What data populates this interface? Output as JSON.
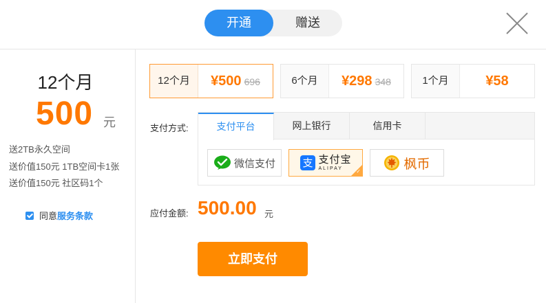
{
  "toggle": {
    "open_label": "开通",
    "gift_label": "赠送"
  },
  "summary": {
    "period": "12个月",
    "price": "500",
    "unit": "元",
    "gifts": [
      "送2TB永久空间",
      "送价值150元 1TB空间卡1张",
      "送价值150元 社区码1个"
    ],
    "agree_prefix": "同意",
    "agree_link": "服务条款"
  },
  "plans": [
    {
      "label": "12个月",
      "price": "¥500",
      "original": "696"
    },
    {
      "label": "6个月",
      "price": "¥298",
      "original": "348"
    },
    {
      "label": "1个月",
      "price": "¥58",
      "original": ""
    }
  ],
  "payment": {
    "label": "支付方式:",
    "tabs": [
      "支付平台",
      "网上银行",
      "信用卡"
    ],
    "options": {
      "wechat": "微信支付",
      "alipay_cn": "支付宝",
      "alipay_en": "ALIPAY",
      "fengbi": "枫币"
    }
  },
  "total": {
    "label": "应付金额:",
    "value": "500.00",
    "unit": "元"
  },
  "pay_button": "立即支付",
  "colors": {
    "accent": "#2d8ff0",
    "price": "#ff7800",
    "button": "#ff8a00",
    "wechat": "#1aad19",
    "alipay": "#1677ff",
    "fengbi": "#f5b400"
  }
}
